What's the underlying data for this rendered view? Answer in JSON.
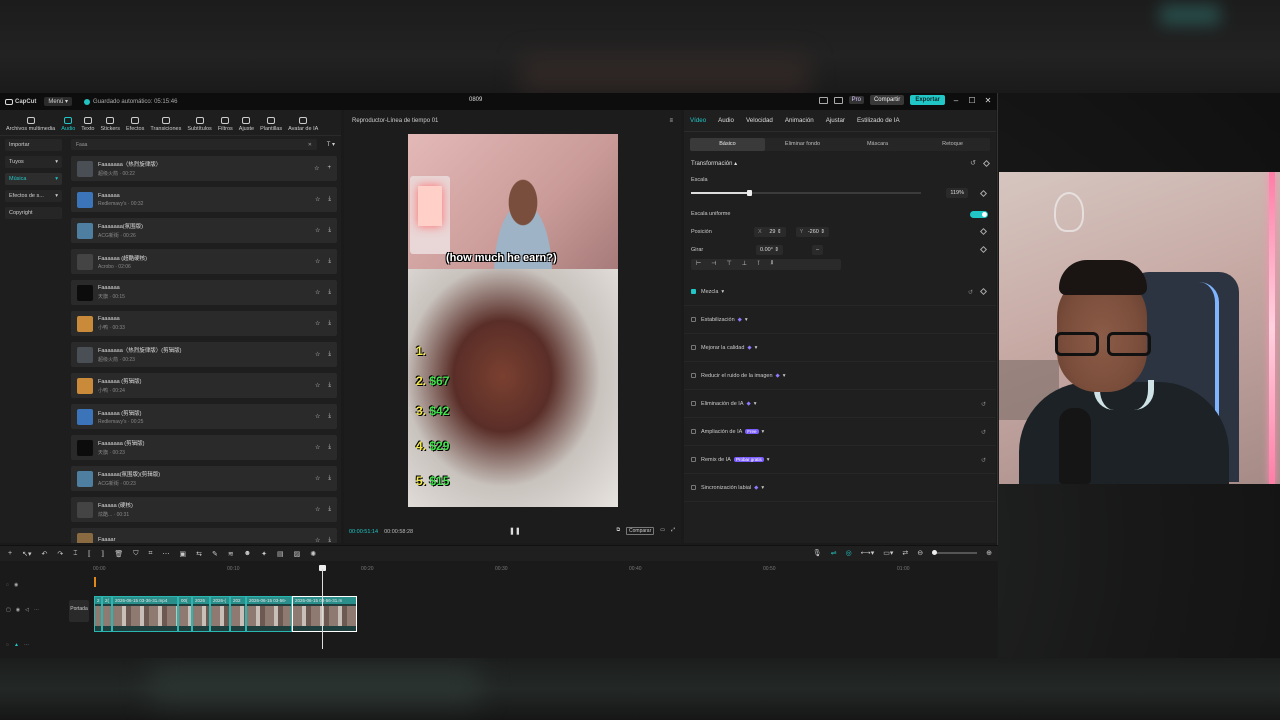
{
  "titlebar": {
    "app_name": "CapCut",
    "menu_label": "Menú",
    "autosave_text": "Guardado automático: 05:15:46",
    "project_title": "0809",
    "pro_label": "Pro",
    "share_label": "Compartir",
    "export_label": "Exportar"
  },
  "tool_tabs": [
    {
      "label": "Archivos multimedia"
    },
    {
      "label": "Audio"
    },
    {
      "label": "Texto"
    },
    {
      "label": "Stickers"
    },
    {
      "label": "Efectos"
    },
    {
      "label": "Transiciones"
    },
    {
      "label": "Subtítulos"
    },
    {
      "label": "Filtros"
    },
    {
      "label": "Ajuste"
    },
    {
      "label": "Plantillas"
    },
    {
      "label": "Avatar de IA"
    }
  ],
  "side_nav": [
    {
      "label": "Importar"
    },
    {
      "label": "Tuyos"
    },
    {
      "label": "Música"
    },
    {
      "label": "Efectos de s..."
    },
    {
      "label": "Copyright"
    }
  ],
  "search": {
    "placeholder": "Faaa"
  },
  "tracks": [
    {
      "title": "Faaaaaaa（热烈旋律版）",
      "sub": "超级火箭 · 00:22",
      "thumb": "#4a4f55"
    },
    {
      "title": "Faaaaaa",
      "sub": "Redlemavy's · 00:32",
      "thumb": "#3b74b8"
    },
    {
      "title": "Faaaaaaa(氛围版)",
      "sub": "ACG新街 · 00:26",
      "thumb": "#4f7fa0"
    },
    {
      "title": "Faaaaaa (超酷硬核)",
      "sub": "Acrobo · 02:06",
      "thumb": "#444"
    },
    {
      "title": "Faaaaaa",
      "sub": "天旗 · 00:15",
      "thumb": "#0c0c0c"
    },
    {
      "title": "Faaaaaa",
      "sub": "小鸭 · 00:33",
      "thumb": "#c98a3a"
    },
    {
      "title": "Faaaaaaa（热烈旋律版）(剪辑版)",
      "sub": "超级火箭 · 00:23",
      "thumb": "#4a4f55"
    },
    {
      "title": "Faaaaaa (剪辑版)",
      "sub": "小鸭 · 00:24",
      "thumb": "#c98a3a"
    },
    {
      "title": "Faaaaaa (剪辑版)",
      "sub": "Redlemavy's · 00:25",
      "thumb": "#3b74b8"
    },
    {
      "title": "Faaaaaaa (剪辑版)",
      "sub": "天旗 · 00:23",
      "thumb": "#0c0c0c"
    },
    {
      "title": "Faaaaaa(氛围版)(剪辑版)",
      "sub": "ACG新街 · 00:23",
      "thumb": "#4f7fa0"
    },
    {
      "title": "Faaaaa (硬核)",
      "sub": "炫酷... · 00:31",
      "thumb": "#444"
    },
    {
      "title": "Faaaar",
      "sub": "",
      "thumb": "#8a6a40"
    }
  ],
  "player": {
    "title": "Reproductor-Línea de tiempo 01",
    "caption": "(how much he earn?)",
    "ranks": [
      {
        "n": "1.",
        "p": ""
      },
      {
        "n": "2.",
        "p": "$67"
      },
      {
        "n": "3.",
        "p": "$42"
      },
      {
        "n": "4.",
        "p": "$29"
      },
      {
        "n": "5.",
        "p": "$15"
      }
    ],
    "current_time": "00:00:51:14",
    "total_time": "00:00:58:28",
    "compare_label": "Comparar"
  },
  "inspector": {
    "tabs": [
      "Vídeo",
      "Audio",
      "Velocidad",
      "Animación",
      "Ajustar",
      "Estilizado de IA"
    ],
    "sub_tabs": [
      "Básico",
      "Eliminar fondo",
      "Máscara",
      "Retoque"
    ],
    "transform_label": "Transformación",
    "scale_label": "Escala",
    "scale_value": "119%",
    "scale_level": 0.25,
    "uniform_label": "Escala uniforme",
    "position_label": "Posición",
    "pos_x_axis": "X",
    "pos_x": "29",
    "pos_y_axis": "Y",
    "pos_y": "-260",
    "rotate_label": "Girar",
    "rotate_value": "0.00°",
    "rotate_extra": "–",
    "features": [
      {
        "label": "Mezcla",
        "checked": true,
        "extra": ""
      },
      {
        "label": "Estabilización",
        "checked": false,
        "extra": ""
      },
      {
        "label": "Mejorar la calidad",
        "checked": false,
        "extra": ""
      },
      {
        "label": "Reducir el ruido de la imagen",
        "checked": false,
        "extra": ""
      },
      {
        "label": "Eliminación de IA",
        "checked": false,
        "extra": ""
      },
      {
        "label": "Ampliación de IA",
        "checked": false,
        "extra": "Free"
      },
      {
        "label": "Remix de IA",
        "checked": false,
        "extra": "Probar gratis"
      },
      {
        "label": "Sincronización labial",
        "checked": false,
        "extra": ""
      }
    ]
  },
  "timeline": {
    "ruler": [
      "00:00",
      "00:10",
      "00:20",
      "00:30",
      "00:40",
      "00:50",
      "01:00"
    ],
    "cover_label": "Portada",
    "clips": [
      {
        "label": "2"
      },
      {
        "label": "2("
      },
      {
        "label": "2026-06-15 03-36-31.mp4"
      },
      {
        "label": "00("
      },
      {
        "label": "2026"
      },
      {
        "label": "2026-("
      },
      {
        "label": "202"
      },
      {
        "label": "2026-06-15 03-56-"
      },
      {
        "label": "2026-06-15 03-56-31.m"
      }
    ]
  },
  "colors": {
    "accent": "#21c6c6",
    "clip": "#2ab7b1"
  }
}
